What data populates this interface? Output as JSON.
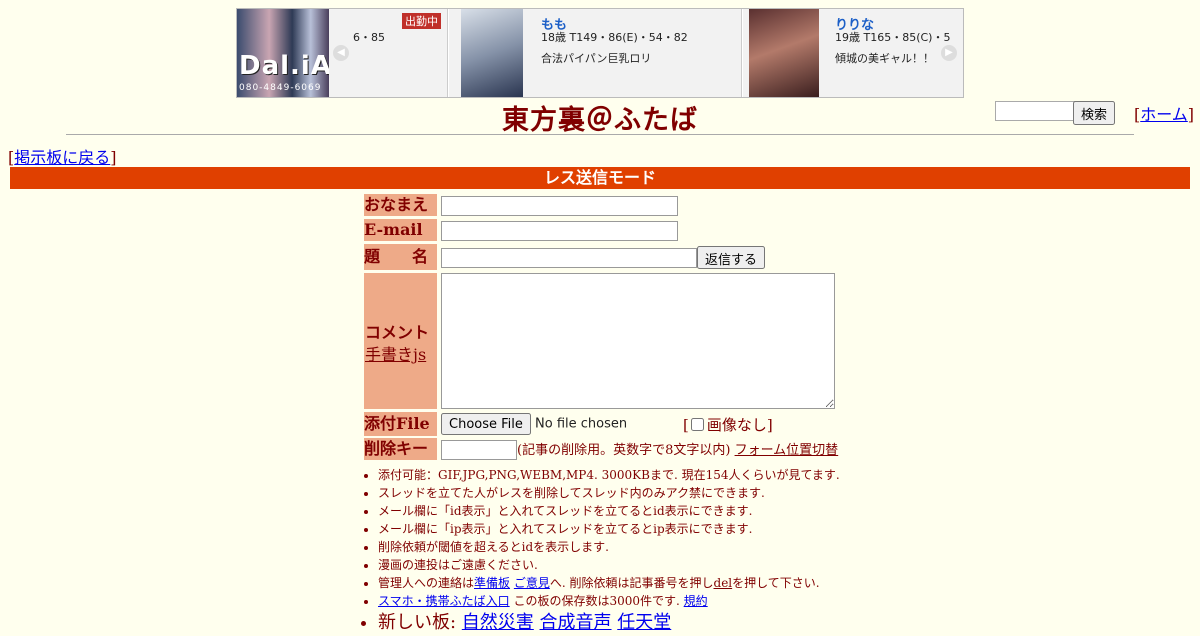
{
  "ad": {
    "logo_text": "Dal.iA",
    "logo_sub": "080-4849-6069",
    "card1": {
      "spec": "6・85",
      "badge": "出勤中"
    },
    "card2": {
      "name": "もも",
      "spec": "18歳 T149・86(E)・54・82",
      "desc": "合法パイパン巨乳ロリ"
    },
    "card3": {
      "name": "りりな",
      "spec": "19歳 T165・85(C)・5",
      "desc": "傾城の美ギャル！！"
    }
  },
  "header": {
    "title": "東方裏＠ふたば",
    "search_button": "検索",
    "home_bracket_open": "[",
    "home_link": "ホーム",
    "home_bracket_close": "]"
  },
  "nav": {
    "open": "[",
    "back_link": "掲示板に戻る",
    "close": "]"
  },
  "form": {
    "mode_title": "レス送信モード",
    "name_label": "おなまえ",
    "email_label": "E-mail",
    "subject_label": "題　　名",
    "submit_button": "返信する",
    "comment_label": "コメント",
    "tegaki_link": "手書きjs",
    "file_label": "添付File",
    "file_button": "Choose File",
    "file_status": "No file chosen",
    "noimage_open": "[",
    "noimage_label": "画像なし",
    "noimage_close": "]",
    "delkey_label": "削除キー",
    "delkey_note": "(記事の削除用。英数字で8文字以内)",
    "form_toggle_link": "フォーム位置切替"
  },
  "rules": {
    "r1": "添付可能：GIF,JPG,PNG,WEBM,MP4. 3000KBまで. 現在154人くらいが見てます.",
    "r2": "スレッドを立てた人がレスを削除してスレッド内のみアク禁にできます.",
    "r3": "メール欄に「id表示」と入れてスレッドを立てるとid表示にできます.",
    "r4": "メール欄に「ip表示」と入れてスレッドを立てるとip表示にできます.",
    "r5": "削除依頼が閾値を超えるとidを表示します.",
    "r6": "漫画の連投はご遠慮ください.",
    "r7_pre": "管理人への連絡は",
    "r7_link1": "準備板",
    "r7_link2": "ご意見",
    "r7_mid": "へ. 削除依頼は記事番号を押し",
    "r7_link3": "del",
    "r7_post": "を押して下さい.",
    "r8_link": "スマホ・携帯ふたば入口",
    "r8_mid": " この板の保存数は3000件です.",
    "r8_link2": "規約",
    "r9_pre": "新しい板: ",
    "r9_links": [
      "自然災害",
      "合成音声",
      "任天堂"
    ]
  }
}
